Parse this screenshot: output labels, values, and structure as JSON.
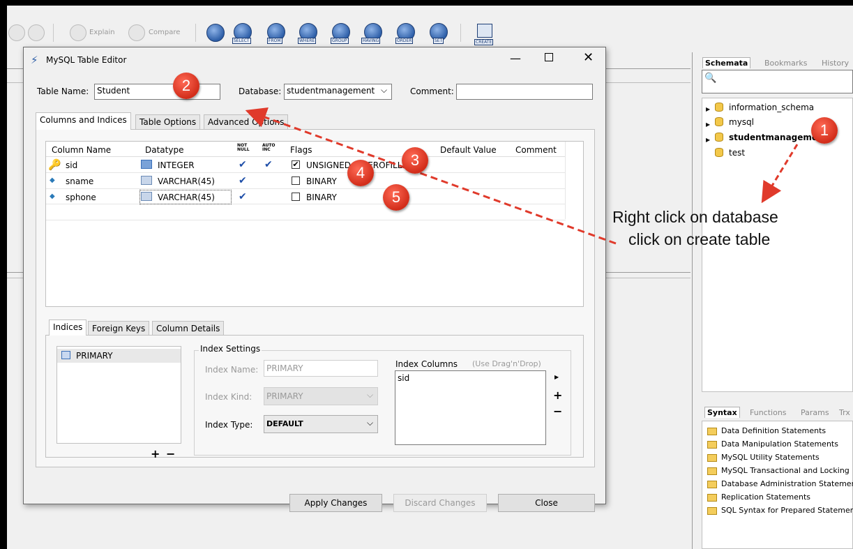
{
  "toolbar": {
    "explain_label": "Explain",
    "compare_label": "Compare",
    "keywords": [
      "SELECT",
      "FROM",
      "WHERE",
      "GROUP",
      "HAVING",
      "ORDER",
      "SET"
    ],
    "create_label": "CREATE"
  },
  "dialog": {
    "title": "MySQL Table Editor",
    "table_name_label": "Table Name:",
    "table_name_value": "Student",
    "database_label": "Database:",
    "database_value": "studentmanagement",
    "comment_label": "Comment:",
    "comment_value": "",
    "tabs": [
      "Columns and Indices",
      "Table Options",
      "Advanced Options"
    ],
    "columns_headers": {
      "name": "Column Name",
      "datatype": "Datatype",
      "notnull": "NOT NULL",
      "autoinc": "AUTO INC",
      "flags": "Flags",
      "default": "Default Value",
      "comment": "Comment"
    },
    "rows": [
      {
        "name": "sid",
        "datatype": "INTEGER",
        "notnull": "✔",
        "autoinc": "✔",
        "flag1": "UNSIGNED",
        "flag2": "ZEROFILL"
      },
      {
        "name": "sname",
        "datatype": "VARCHAR(45)",
        "notnull": "✔",
        "autoinc": "",
        "flag1": "BINARY"
      },
      {
        "name": "sphone",
        "datatype": "VARCHAR(45)",
        "notnull": "✔",
        "autoinc": "",
        "flag1": "BINARY"
      }
    ],
    "bottom_tabs": [
      "Indices",
      "Foreign Keys",
      "Column Details"
    ],
    "indices": [
      "PRIMARY"
    ],
    "plus": "+",
    "minus": "−",
    "index_settings_label": "Index Settings",
    "index_name_label": "Index Name:",
    "index_name_value": "PRIMARY",
    "index_kind_label": "Index Kind:",
    "index_kind_value": "PRIMARY",
    "index_type_label": "Index Type:",
    "index_type_value": "DEFAULT",
    "index_columns_label": "Index Columns",
    "index_columns_hint": "(Use Drag'n'Drop)",
    "index_columns": [
      "sid"
    ],
    "apply_label": "Apply Changes",
    "discard_label": "Discard Changes",
    "close_label": "Close"
  },
  "schemata": {
    "tabs": [
      "Schemata",
      "Bookmarks",
      "History"
    ],
    "items": [
      "information_schema",
      "mysql",
      "studentmanagement",
      "test"
    ]
  },
  "syntax": {
    "tabs": [
      "Syntax",
      "Functions",
      "Params",
      "Trx"
    ],
    "items": [
      "Data Definition Statements",
      "Data Manipulation Statements",
      "MySQL Utility Statements",
      "MySQL Transactional and Locking",
      "Database Administration Statements",
      "Replication Statements",
      "SQL Syntax for Prepared Statements"
    ]
  },
  "annotations": {
    "markers": [
      "1",
      "2",
      "3",
      "4",
      "5"
    ],
    "note_line1": "Right click on database",
    "note_line2": "click on create table",
    "arrow_color": "#e03a2b"
  }
}
